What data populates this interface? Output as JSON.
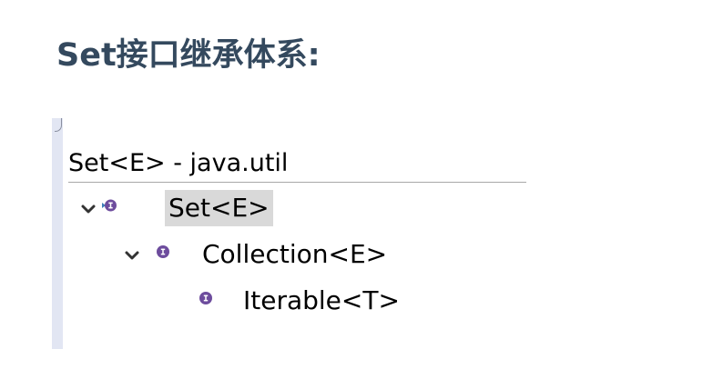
{
  "heading": "Set接口继承体系:",
  "hierarchy_view": {
    "title": "Set<E> - java.util",
    "nodes": [
      {
        "label": "Set<E>",
        "expanded": true,
        "selected": true,
        "icon": "interface-icon"
      },
      {
        "label": "Collection<E>",
        "expanded": true,
        "selected": false,
        "icon": "interface-icon"
      },
      {
        "label": "Iterable<T>",
        "expanded": false,
        "selected": false,
        "icon": "interface-icon"
      }
    ]
  },
  "colors": {
    "heading": "#34495e",
    "selection": "#d9d9d9",
    "interface_icon": "#6d4c9d",
    "panel_edge": "#e2e6f3"
  }
}
